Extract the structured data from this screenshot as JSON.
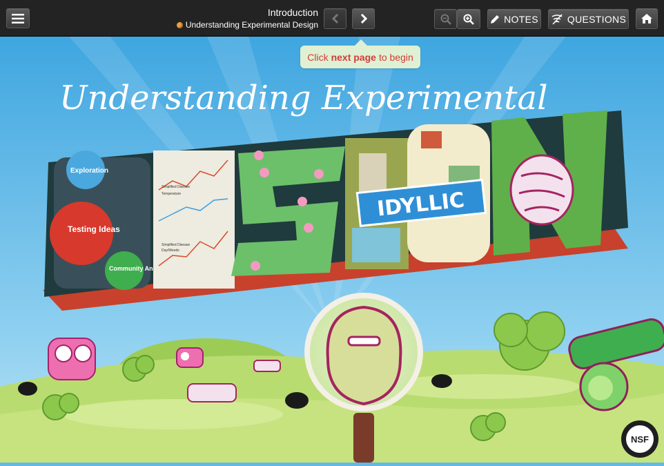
{
  "toolbar": {
    "menu_icon": "hamburger-menu-icon",
    "title": "Introduction",
    "subtitle": "Understanding Experimental Design",
    "prev_icon": "chevron-left-icon",
    "next_icon": "chevron-right-icon",
    "zoom_out_icon": "zoom-out-icon",
    "zoom_in_icon": "zoom-in-icon",
    "notes_label": "NOTES",
    "questions_label": "QUESTIONS",
    "home_icon": "home-icon"
  },
  "tooltip": {
    "prefix": "Click",
    "bold": "next page",
    "suffix": "to begin"
  },
  "hero": {
    "headline": "Understanding Experimental",
    "big_word": "DESIGN",
    "sign_text": "IDYLLIC",
    "cycle_labels": [
      "Exploration",
      "Testing Ideas",
      "Community Analysis"
    ],
    "chart_labels": [
      "Simplified Disease",
      "Temperature",
      "Simplified Disease",
      "Day/Weeds"
    ],
    "badge": "NSF"
  },
  "colors": {
    "topbar": "#232323",
    "sky": "#62b8e6",
    "grass": "#b5d86a",
    "tooltip_bg": "#e0f0d2",
    "tooltip_text": "#d23b3b",
    "letter_side": "#1f3b3d",
    "letter_base": "#c8412c"
  }
}
